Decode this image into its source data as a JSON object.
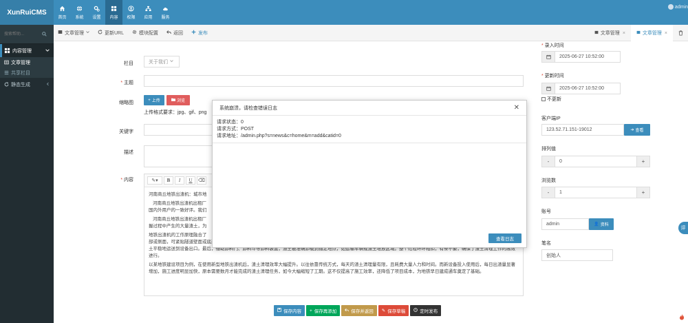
{
  "app": {
    "logo_text": "XunRuiCMS",
    "user_name": "admin"
  },
  "topnav": [
    {
      "label": "首页",
      "icon": "home-icon"
    },
    {
      "label": "系统",
      "icon": "globe-icon"
    },
    {
      "label": "设置",
      "icon": "cogs-icon"
    },
    {
      "label": "内容",
      "icon": "grid-icon",
      "active": true
    },
    {
      "label": "权限",
      "icon": "user-icon"
    },
    {
      "label": "应用",
      "icon": "sitemap-icon"
    },
    {
      "label": "服务",
      "icon": "cloud-icon"
    }
  ],
  "sidebar": {
    "search_placeholder": "搜索帮助...",
    "group_label": "内容管理",
    "sub_items": [
      {
        "label": "文章管理",
        "active": true
      },
      {
        "label": "共享栏目",
        "active": false
      }
    ],
    "static_label": "静态生成"
  },
  "toolbar": {
    "items": [
      {
        "label": "文章管理",
        "icon": "list-icon"
      },
      {
        "label": "更新URL",
        "icon": "refresh-icon"
      },
      {
        "label": "模块配置",
        "icon": "gear-icon"
      },
      {
        "label": "返回",
        "icon": "reply-icon"
      },
      {
        "label": "发布",
        "icon": "plus-icon"
      }
    ],
    "tabs": [
      {
        "label": "文章管理",
        "active": false
      },
      {
        "label": "文章管理",
        "active": true
      }
    ]
  },
  "form": {
    "category_label": "栏目",
    "category_value": "关于我们",
    "title_label": "主题",
    "thumb_label": "缩略图",
    "upload_label": "上传",
    "browse_label": "浏览",
    "upload_hint": "上传格式要求：jpg、gif、png",
    "keyword_label": "关键字",
    "desc_label": "描述",
    "content_label": "内容",
    "editor_paragraphs": [
      "河南商丘地铁出渣机：城市地",
      "河南商丘地铁出渣机出租厂",
      "国内外用户的一致好评。我们",
      "河南商丘地铁出渣机出租厂",
      "握过程中产生的大量渣土，为",
      "地铁出渣机的工作原理融合了",
      "部或侧面，可紧贴隧道壁面或底部，将渣土快速刮下或吸取到设备中。随后，渣土进入内部输送系统，常见的有螺旋输送机、链式输送机或皮带输送机等，它们如同一条条“钢铁动脉”，将渣土平稳地运送到设备出口。最后，借助卸料门、卸料斗等卸料装置，渣土被准确卸载到指定地点，如运输车辆或渣土堆放区域。整个过程环环相扣，有条不紊，确保了渣土清理工作的高效进行。",
      "以某地铁建设项目为例，在使用新型地铁出渣机后，渣土清理效率大幅提升。以往依靠传统方式，每天的渣土清理量有限，且耗费大量人力和时间。而新设备投入使用后，每日出渣量显著增加，施工进度明显加快，原本需要数月才能完成的渣土清理任务，如今大幅缩短了工期。这不仅提高了施工效率，还降低了项目成本，为地铁早日建成通车奠定了基础。"
    ]
  },
  "right": {
    "entry_time_label": "录入时间",
    "entry_time_value": "2025-06-27 10:52:00",
    "update_time_label": "更新时间",
    "update_time_value": "2025-06-27 10:52:00",
    "no_update_label": "不更新",
    "client_ip_label": "客户端IP",
    "client_ip_value": "123.52.71.151-19012",
    "view_label": "查看",
    "sort_label": "排列值",
    "sort_value": "0",
    "views_label": "浏览数",
    "views_value": "1",
    "account_label": "账号",
    "account_value": "admin",
    "profile_label": "资料",
    "author_label": "笔名",
    "author_value": "创始人"
  },
  "actions": [
    {
      "label": "保存内容",
      "color": "#3c8dbc"
    },
    {
      "label": "保存再添加",
      "color": "#00a65a"
    },
    {
      "label": "保存并返回",
      "color": "#c19a4b"
    },
    {
      "label": "保存草稿",
      "color": "#dd4b39"
    },
    {
      "label": "定时发布",
      "color": "#333333"
    }
  ],
  "modal": {
    "title": "系统崩溃，请检查错误日志",
    "status_line": "请求状态：0",
    "method_line": "请求方式：POST",
    "url_line": "请求地址：/admin.php?s=news&c=home&m=add&catid=0",
    "button_label": "查看日志"
  },
  "side_badge": "评"
}
